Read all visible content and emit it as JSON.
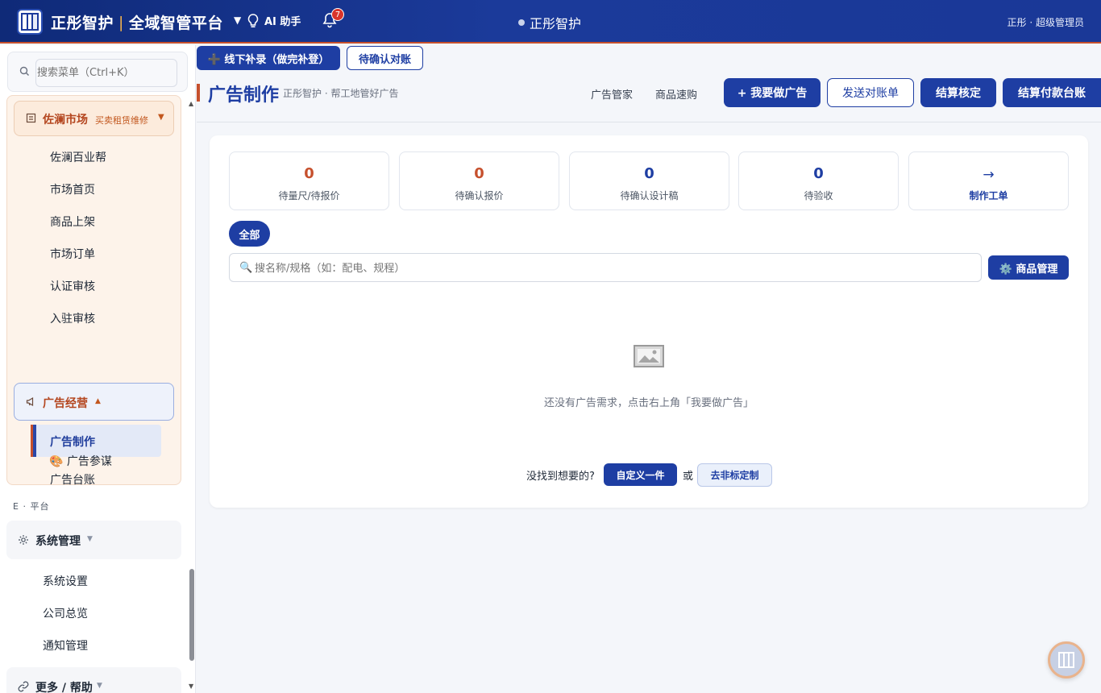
{
  "header": {
    "brand_name": "正彤智护",
    "platform_name": "全域智管平台",
    "dropdown_caret": "▼",
    "ai_label": "AI 助手",
    "notification_count": "7",
    "center_title": "正彤智护",
    "user": "正彤 · 超级管理员"
  },
  "sidebar": {
    "search_placeholder": "搜索菜单（Ctrl+K）",
    "market": {
      "label": "佐澜市场",
      "sub": "买卖租赁维修",
      "arrow": "▼",
      "items": [
        "佐澜百业帮",
        "市场首页",
        "商品上架",
        "市场订单",
        "认证审核",
        "入驻审核"
      ]
    },
    "ads": {
      "label": "广告经营",
      "arrow": "▲",
      "items": [
        "广告制作",
        "广告台账",
        "🎨 广告参谋"
      ],
      "active": "广告制作"
    },
    "section_label": "E · 平台",
    "system": {
      "label": "系统管理",
      "arrow": "▼",
      "items": [
        "系统设置",
        "公司总览",
        "通知管理"
      ]
    },
    "more": {
      "label": "更多 / 帮助",
      "arrow": "▼"
    }
  },
  "quick_actions": {
    "offline_record": "➕ 线下补录（做完补登）",
    "pending_reconcile": "待确认对账"
  },
  "page": {
    "title": "广告制作",
    "subtitle": "正彤智护 · 帮工地管好广告",
    "tabs": [
      "广告管家",
      "商品速购"
    ],
    "buttons": {
      "make_ad": "+ 我要做广告",
      "send_statement": "发送对账单",
      "settle_check": "结算核定",
      "settle_ledger": "结算付款台账"
    }
  },
  "stats": [
    {
      "value": "0",
      "label": "待量尺/待报价",
      "color": "#c6502d"
    },
    {
      "value": "0",
      "label": "待确认报价",
      "color": "#c6502d"
    },
    {
      "value": "0",
      "label": "待确认设计稿",
      "color": "#1e3ea3"
    },
    {
      "value": "0",
      "label": "待验收",
      "color": "#1e3ea3"
    }
  ],
  "work_order": {
    "arrow": "→",
    "label": "制作工单"
  },
  "filter": {
    "all": "全部"
  },
  "search": {
    "icon": "🔍",
    "placeholder": "搜名称/规格（如：配电、规程）"
  },
  "goods_button": "⚙️ 商品管理",
  "empty": {
    "icon": "image-icon",
    "text": "还没有广告需求，点击右上角「我要做广告」"
  },
  "footer": {
    "notfound": "没找到想要的?",
    "custom": "自定义一件",
    "or": "或",
    "nonstandard": "去非标定制"
  }
}
